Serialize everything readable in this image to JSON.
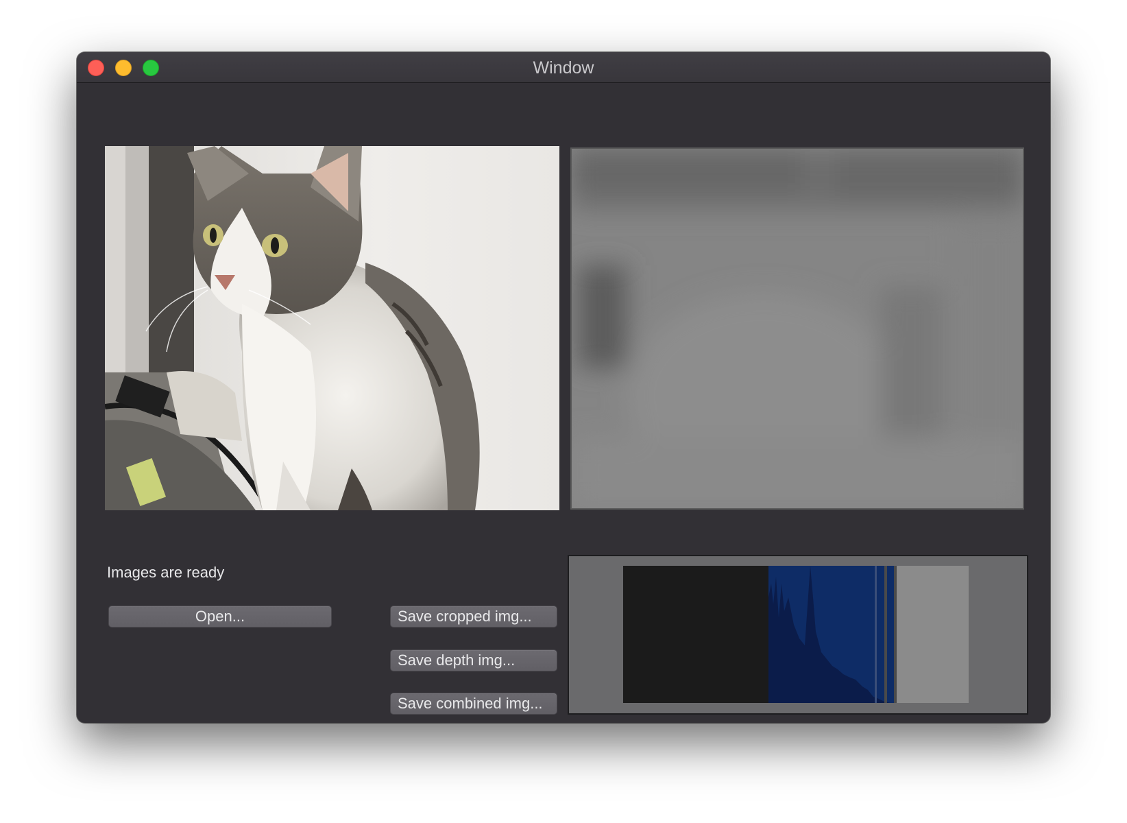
{
  "window": {
    "title": "Window"
  },
  "status": {
    "text": "Images are ready"
  },
  "buttons": {
    "open": "Open...",
    "save_cropped": "Save cropped img...",
    "save_depth": "Save depth img...",
    "save_combined": "Save combined img..."
  },
  "colors": {
    "window_bg": "#323035",
    "close": "#fe5f57",
    "minimize": "#febc2e",
    "zoom": "#28c840",
    "histogram_blue": "#0d2f6a"
  }
}
